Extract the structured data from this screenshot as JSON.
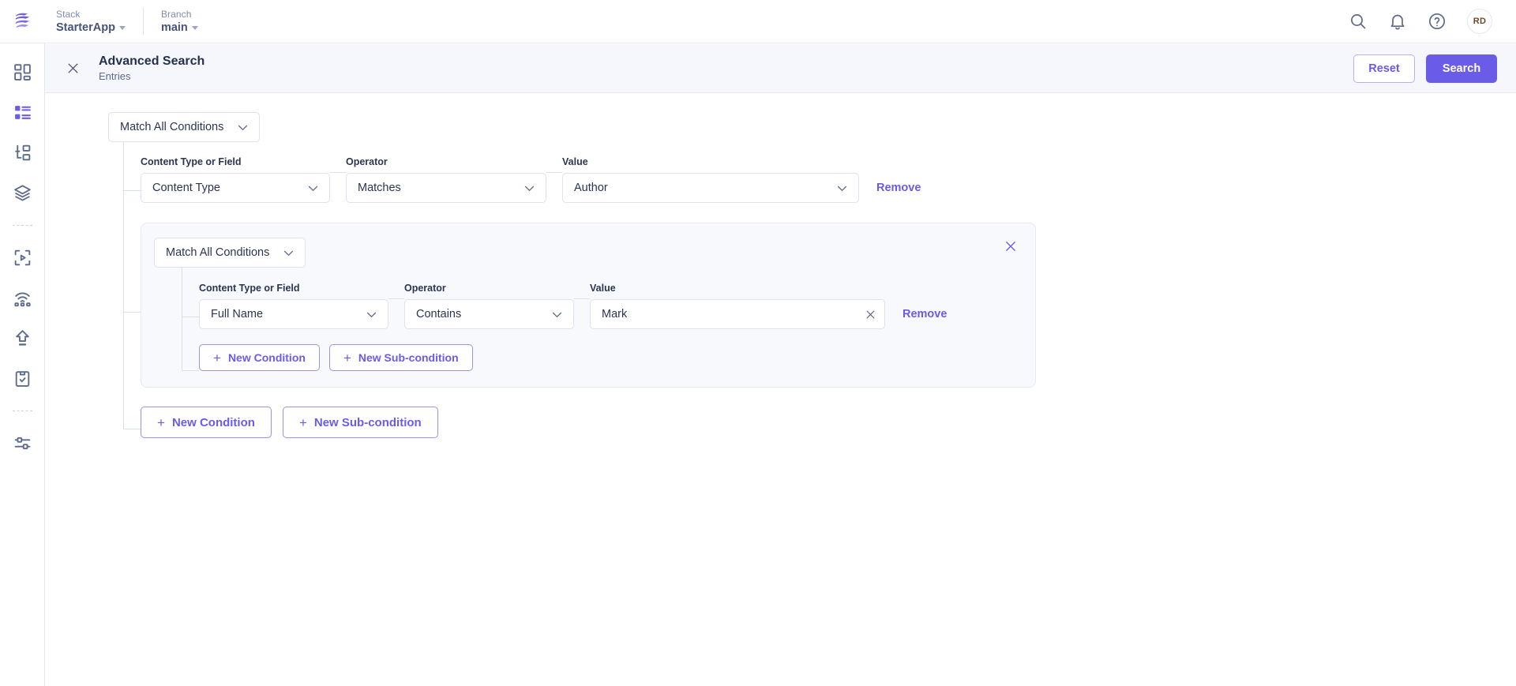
{
  "topbar": {
    "logo_name": "contentstack-logo",
    "breadcrumbs": [
      {
        "label": "Stack",
        "value": "StarterApp"
      },
      {
        "label": "Branch",
        "value": "main"
      }
    ],
    "icons": [
      "search-icon",
      "notification-bell-icon",
      "help-circle-icon"
    ],
    "avatar_initials": "RD"
  },
  "sidebar": {
    "items": [
      {
        "name": "dashboard-icon",
        "active": false
      },
      {
        "name": "entries-icon",
        "active": true
      },
      {
        "name": "content-types-icon",
        "active": false
      },
      {
        "name": "stacks-layers-icon",
        "active": false
      },
      {
        "name": "divider-1",
        "active": false
      },
      {
        "name": "assets-media-icon",
        "active": false
      },
      {
        "name": "live-preview-icon",
        "active": false
      },
      {
        "name": "releases-icon",
        "active": false
      },
      {
        "name": "tasks-checklist-icon",
        "active": false
      },
      {
        "name": "divider-2",
        "active": false
      },
      {
        "name": "settings-sliders-icon",
        "active": false
      }
    ]
  },
  "panel": {
    "close_icon": "close-icon",
    "title": "Advanced Search",
    "subtitle": "Entries",
    "reset_label": "Reset",
    "search_label": "Search"
  },
  "builder": {
    "root_match": {
      "value": "Match All Conditions",
      "chevron": "chevron-down-icon"
    },
    "labels": {
      "field": "Content Type or Field",
      "operator": "Operator",
      "value": "Value"
    },
    "condition_1": {
      "field": "Content Type",
      "operator": "Matches",
      "value": "Author",
      "remove_label": "Remove"
    },
    "subgroup": {
      "match": "Match All Conditions",
      "close_icon": "close-icon",
      "condition": {
        "field": "Full Name",
        "operator": "Contains",
        "value": "Mark",
        "clear_icon": "close-icon",
        "remove_label": "Remove"
      },
      "new_condition_label": "New Condition",
      "new_subcondition_label": "New Sub-condition"
    },
    "new_condition_label": "New Condition",
    "new_subcondition_label": "New Sub-condition"
  },
  "colors": {
    "accent": "#6b5ce7",
    "accent_dark": "#5b4cd6",
    "header_bg": "#f5f7fd",
    "group_bg": "#f7f9fd",
    "border": "#dde2ee",
    "text": "#2b3550",
    "muted": "#5d6a87"
  }
}
